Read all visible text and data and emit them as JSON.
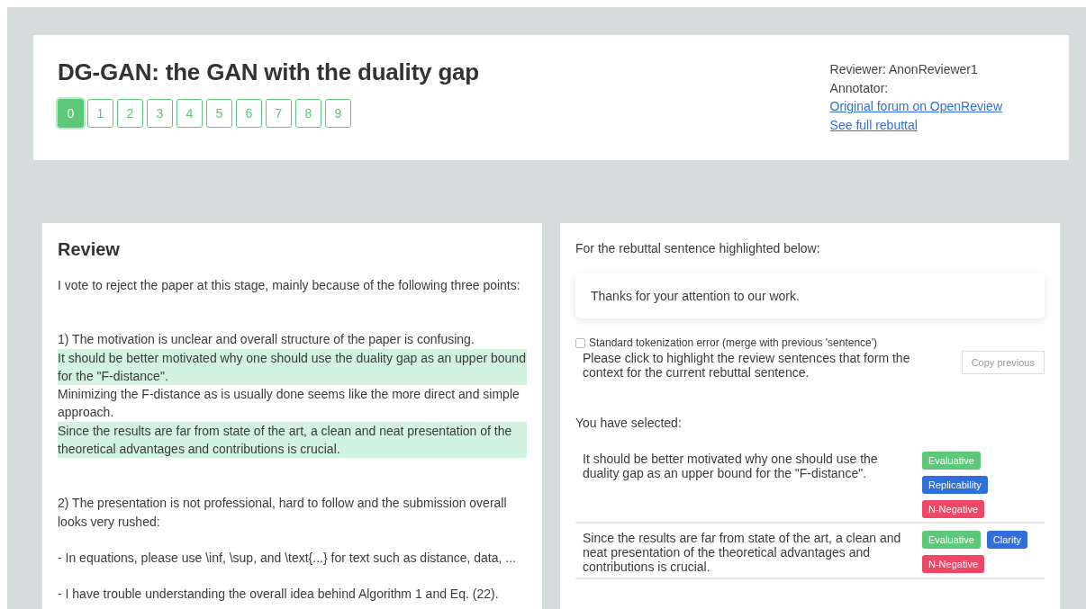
{
  "header": {
    "title": "DG-GAN: the GAN with the duality gap",
    "pages": [
      {
        "label": "0",
        "selected": true
      },
      {
        "label": "1",
        "selected": false
      },
      {
        "label": "2",
        "selected": false
      },
      {
        "label": "3",
        "selected": false
      },
      {
        "label": "4",
        "selected": false
      },
      {
        "label": "5",
        "selected": false
      },
      {
        "label": "6",
        "selected": false
      },
      {
        "label": "7",
        "selected": false
      },
      {
        "label": "8",
        "selected": false
      },
      {
        "label": "9",
        "selected": false
      }
    ],
    "reviewer": "Reviewer: AnonReviewer1",
    "annotator": "Annotator:",
    "links": [
      "Original forum on OpenReview",
      "See full rebuttal"
    ]
  },
  "review": {
    "title": "Review",
    "paragraphs": [
      [
        {
          "text": "I vote to reject the paper at this stage, mainly because of the following three points:",
          "highlighted": false
        }
      ],
      [
        {
          "text": "1) The motivation is unclear and overall structure of the paper is confusing.",
          "highlighted": false
        },
        {
          "text": "It should be better motivated why one should use the duality gap as an upper bound for the \"F-distance\".",
          "highlighted": true
        },
        {
          "text": "Minimizing the F-distance as is usually done seems like the more direct and simple approach.",
          "highlighted": false
        },
        {
          "text": "Since the results are far from state of the art, a clean and neat presentation of the theoretical advantages and contributions is crucial.",
          "highlighted": true
        }
      ],
      [
        {
          "text": "2) The presentation is not professional, hard to follow and the submission overall looks very rushed:",
          "highlighted": false
        }
      ],
      [
        {
          "text": "- In equations, please use \\inf, \\sup, and \\text{...} for text such as distance, data, ...",
          "highlighted": false
        }
      ],
      [
        {
          "text": "- I have trouble understanding the overall idea behind Algorithm 1 and Eq. (22).",
          "highlighted": false
        }
      ]
    ]
  },
  "annotation": {
    "intro": "For the rebuttal sentence highlighted below:",
    "rebuttal_sentence": "Thanks for your attention to our work.",
    "tokenization_error": {
      "label": "Standard tokenization error (merge with previous 'sentence')",
      "checked": false
    },
    "instruction": "Please click to highlight the review sentences that form the context for the current rebuttal sentence.",
    "copy_button": {
      "label": "Copy previous",
      "disabled": true
    },
    "selected_heading": "You have selected:",
    "selected": [
      {
        "text": "It should be better motivated why one should use the duality gap as an upper bound for the \"F-distance\".",
        "tags": [
          {
            "label": "Evaluative",
            "color": "#5cc879"
          },
          {
            "label": "Replicability",
            "color": "#2f6fdb"
          },
          {
            "label": "N-Negative",
            "color": "#ef4766"
          }
        ]
      },
      {
        "text": "Since the results are far from state of the art, a clean and neat presentation of the theoretical advantages and contributions is crucial.",
        "tags": [
          {
            "label": "Evaluative",
            "color": "#5cc879"
          },
          {
            "label": "Clarity",
            "color": "#2f6fdb"
          },
          {
            "label": "N-Negative",
            "color": "#ef4766"
          }
        ]
      }
    ]
  }
}
